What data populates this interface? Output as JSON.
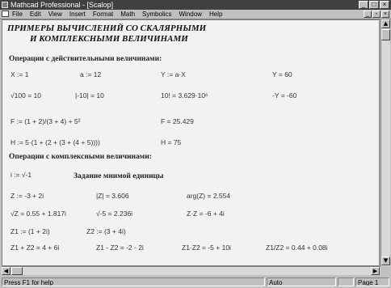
{
  "window": {
    "title": "Mathcad Professional - [Scalop]"
  },
  "window_buttons": {
    "minimize": "_",
    "maximize": "□",
    "close": "×"
  },
  "menu": {
    "items": [
      "File",
      "Edit",
      "View",
      "Insert",
      "Format",
      "Math",
      "Symbolics",
      "Window",
      "Help"
    ]
  },
  "doc_buttons": {
    "minimize": "_",
    "restore": "▫",
    "close": "×"
  },
  "worksheet": {
    "heading_line1": "ПРИМЕРЫ ВЫЧИСЛЕНИЙ СО СКАЛЯРНЫМИ",
    "heading_line2": "И КОМПЛЕКСНЫМИ ВЕЛИЧИНАМИ",
    "section_real": "Операции с действительными величинами:",
    "real_rows": [
      [
        "X := 1",
        "a := 12",
        "Y := a·X",
        "Y = 60"
      ],
      [
        "√100 = 10",
        "|-10| = 10",
        "10! = 3.629·10⁶",
        "-Y = -60"
      ],
      [
        "F := (1 + 2)/(3 + 4) + 5²",
        "F = 25.429"
      ],
      [
        "H := 5·(1 + (2 + (3 + (4 + 5))))",
        "H = 75"
      ]
    ],
    "section_complex": "Операции с комплексными величинами:",
    "imaginary_def": "i := √-1",
    "imaginary_title": "Задание мнимой единицы",
    "complex_rows": [
      [
        "Z := -3 + 2i",
        "|Z| = 3.606",
        "arg(Z) = 2.554"
      ],
      [
        "√Z = 0.55 + 1.817i",
        "√-5 = 2.236i",
        "Z·Z = -6 + 4i"
      ],
      [
        "Z1 := (1 + 2i)",
        "Z2 := (3 + 4i)"
      ],
      [
        "Z1 + Z2 = 4 + 6i",
        "Z1 - Z2 = -2 - 2i",
        "Z1·Z2 = -5 + 10i",
        "Z1/Z2 = 0.44 + 0.08i"
      ]
    ]
  },
  "status": {
    "help": "Press F1 for help",
    "mode": "Auto",
    "page": "Page 1"
  }
}
